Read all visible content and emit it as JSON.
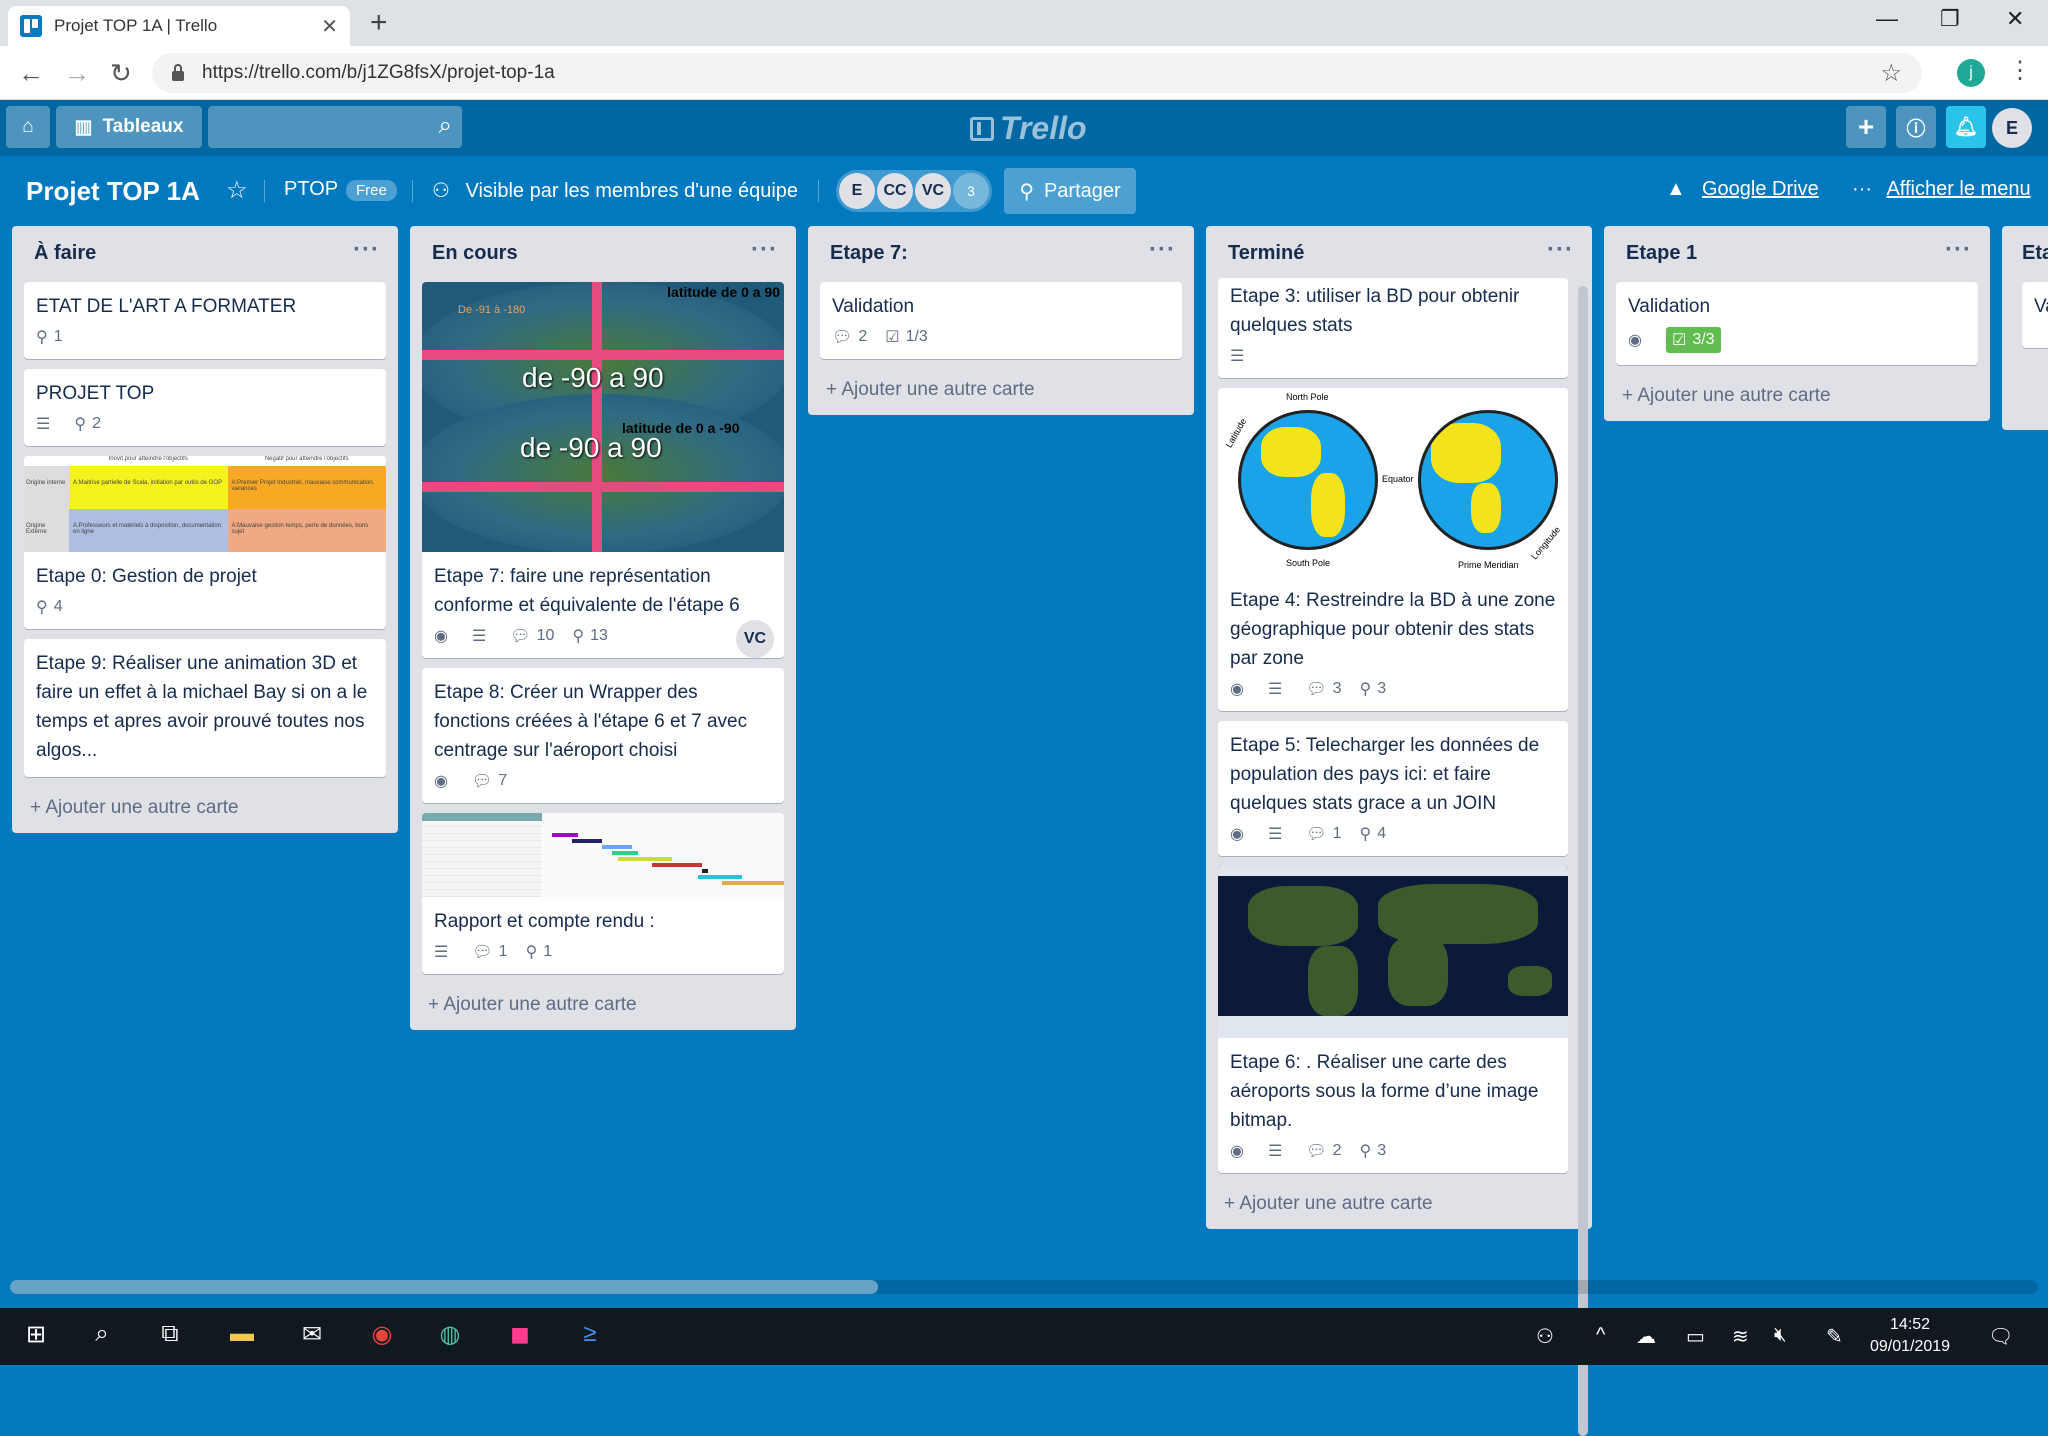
{
  "browser": {
    "tab_title": "Projet TOP 1A | Trello",
    "tab_close": "✕",
    "new_tab": "+",
    "url": "https://trello.com/b/j1ZG8fsX/projet-top-1a",
    "profile_initial": "j"
  },
  "header": {
    "boards_label": "Tableaux",
    "logo_text": "Trello",
    "user_initial": "E"
  },
  "board": {
    "title": "Projet TOP 1A",
    "team": "PTOP",
    "plan": "Free",
    "visibility": "Visible par les membres d'une équipe",
    "members": [
      "E",
      "CC",
      "VC"
    ],
    "member_count": "3",
    "share_label": "Partager",
    "gdrive_label": "Google Drive",
    "menu_label": "Afficher le menu"
  },
  "lists": [
    {
      "title": "À faire",
      "add_label": "Ajouter une autre carte",
      "cards": [
        {
          "text": "ETAT DE L'ART A FORMATER",
          "attachments": "1"
        },
        {
          "text": "PROJET TOP",
          "attachments": "2"
        },
        {
          "text": "Etape 0: Gestion de projet",
          "attachments": "4"
        },
        {
          "text": "Etape 9: Réaliser une animation 3D et faire un effet à la michael Bay si on a le temps et apres avoir prouvé toutes nos algos..."
        }
      ],
      "grid_text": {
        "h1": "Inovit pour atteindre l'objectifs",
        "h2": "Negatif pour atteindre l'objectifs",
        "r1": "Origine interne",
        "r2": "Origine Externe",
        "c11": "A:Maitrise partielle de Scala, initiation par outils de GOP",
        "c12": "A:Premier Projet Industriel, mauvaise communication, vacances",
        "c21": "A:Professeurs et matériels à disposition, documentation en ligne",
        "c22": "A:Mauvaise gestion temps, perte de données, bons sujet"
      }
    },
    {
      "title": "En cours",
      "add_label": "Ajouter une autre carte",
      "cards": [
        {
          "text": "Etape 7: faire une représentation conforme et équivalente de l'étape 6",
          "comments": "10",
          "attachments": "13",
          "member": "VC",
          "img": {
            "top_right": "latitude de 0 a 90",
            "top_left": "De -91 à -180",
            "big1": "de -90 a 90",
            "mid": "latitude de 0 a -90",
            "big2": "de -90 a 90"
          }
        },
        {
          "text": "Etape 8: Créer un Wrapper des fonctions créées à l'étape 6 et 7 avec centrage sur l'aéroport choisi",
          "comments": "7"
        },
        {
          "text": "Rapport et compte rendu :",
          "comments": "1",
          "attachments": "1"
        }
      ]
    },
    {
      "title": "Etape 7:",
      "add_label": "Ajouter une autre carte",
      "cards": [
        {
          "text": "Validation",
          "comments": "2",
          "checklist": "1/3"
        }
      ]
    },
    {
      "title": "Terminé",
      "add_label": "Ajouter une autre carte",
      "cards": [
        {
          "text": "Etape 3: utiliser la BD pour obtenir quelques stats"
        },
        {
          "text": "Etape 4: Restreindre la BD à une zone géographique pour obtenir des stats par zone",
          "comments": "3",
          "attachments": "3",
          "img": {
            "north": "North Pole",
            "south": "South Pole",
            "equator": "Equator",
            "latitude": "Latitude",
            "meridian": "Prime Meridian",
            "longitude": "Longitude"
          }
        },
        {
          "text": "Etape 5: Telecharger les données de population des pays ici: et faire quelques stats grace a un JOIN",
          "comments": "1",
          "attachments": "4"
        },
        {
          "text": "Etape 6: . Réaliser une carte des aéroports sous la forme d’une image bitmap.",
          "comments": "2",
          "attachments": "3"
        }
      ]
    },
    {
      "title": "Etape 1",
      "add_label": "Ajouter une autre carte",
      "cards": [
        {
          "text": "Validation",
          "checklist": "3/3"
        }
      ]
    },
    {
      "title": "Eta",
      "cards": [
        {
          "text": "Va"
        }
      ]
    }
  ],
  "taskbar": {
    "time": "14:52",
    "date": "09/01/2019"
  },
  "colors": {
    "board_bg": "#0079bf",
    "header_bg": "#0067a3",
    "list_bg": "#dfe1e6",
    "green_badge": "#61bd4f",
    "pink_lines": "#e84a7f"
  }
}
